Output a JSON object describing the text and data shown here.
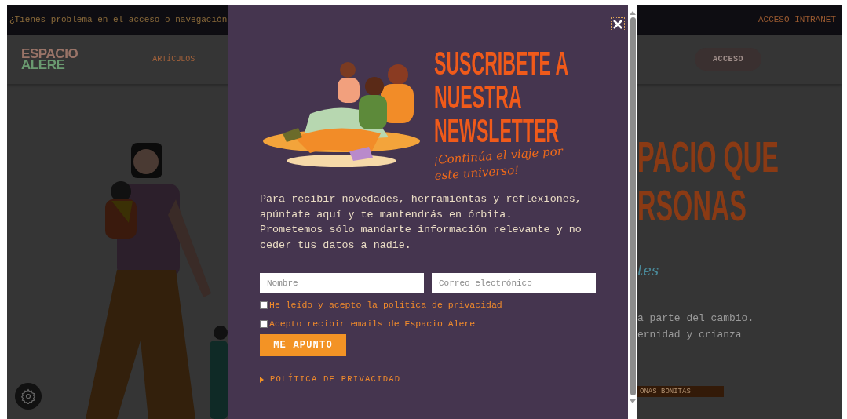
{
  "top_bar": {
    "notice": "¿Tienes problema en el acceso o navegación",
    "link": "ACCESO INTRANET"
  },
  "header": {
    "logo_lines": [
      "ESPACIO",
      "ALERE"
    ],
    "nav": [
      "ARTÍCULOS"
    ],
    "login_button": "ACCESO"
  },
  "hero": {
    "heading_lines": [
      "PACIO QUE",
      "RSONAS"
    ],
    "script_text": "tes",
    "body_lines": [
      "a parte del cambio.",
      "ernidad y crianza"
    ],
    "button": "ONAS BONITAS"
  },
  "modal": {
    "title_lines": [
      "SUSCRIBETE A",
      "NUESTRA",
      "NEWSLETTER"
    ],
    "subtitle_lines": [
      "¡Continúa el viaje por",
      "este universo!"
    ],
    "paragraphs": [
      "Para recibir novedades, herramientas y reflexiones, apúntate aquí y te mantendrás en órbita.",
      "Prometemos sólo mandarte información relevante y no ceder tus datos a nadie."
    ],
    "fields": [
      {
        "placeholder": "Nombre"
      },
      {
        "placeholder": "Correo electrónico"
      }
    ],
    "checkboxes": [
      {
        "label": "He leído y acepto la política de privacidad",
        "checked": false
      },
      {
        "label": "Acepto recibir emails de Espacio Alere",
        "checked": false
      }
    ],
    "submit": "ME APUNTO",
    "disclosure": {
      "label": "POLÍTICA DE PRIVACIDAD",
      "expanded": false
    }
  }
}
